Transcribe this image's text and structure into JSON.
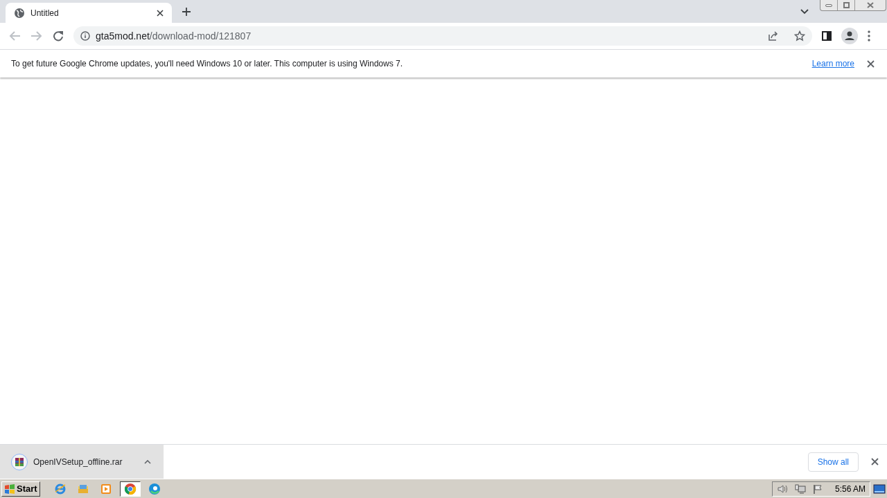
{
  "tab": {
    "title": "Untitled",
    "selected": true
  },
  "address": {
    "host": "gta5mod.net",
    "path": "/download-mod/121807"
  },
  "infobar": {
    "message": "To get future Google Chrome updates, you'll need Windows 10 or later. This computer is using Windows 7.",
    "link": "Learn more"
  },
  "download_bar": {
    "file": "OpenIVSetup_offline.rar",
    "show_all": "Show all"
  },
  "taskbar": {
    "start": "Start",
    "apps": [
      {
        "kind": "ie",
        "selected": false
      },
      {
        "kind": "explorer",
        "selected": false
      },
      {
        "kind": "media",
        "selected": false
      },
      {
        "kind": "chrome",
        "selected": true
      },
      {
        "kind": "edge",
        "selected": false
      }
    ],
    "clock": "5:56 AM"
  }
}
